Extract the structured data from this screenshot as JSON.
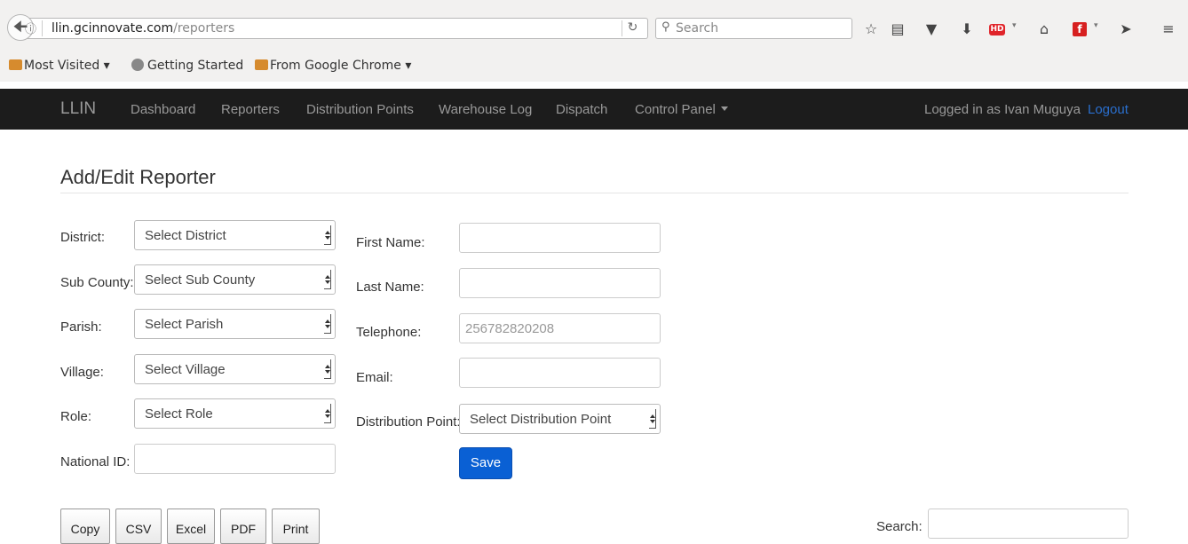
{
  "browser": {
    "url_host": "llin.gcinnovate.com",
    "url_path": "/reporters",
    "search_placeholder": "Search",
    "bookmarks": [
      "Most Visited ▾",
      "Getting Started",
      "From Google Chrome ▾"
    ]
  },
  "navbar": {
    "brand": "LLIN",
    "links": [
      "Dashboard",
      "Reporters",
      "Distribution Points",
      "Warehouse Log",
      "Dispatch",
      "Control Panel"
    ],
    "logged_in_text": "Logged in as Ivan Muguya",
    "logout": "Logout"
  },
  "page": {
    "title": "Add/Edit Reporter"
  },
  "form": {
    "district_label": "District:",
    "district_value": "Select District",
    "subcounty_label": "Sub County:",
    "subcounty_value": "Select Sub County",
    "parish_label": "Parish:",
    "parish_value": "Select Parish",
    "village_label": "Village:",
    "village_value": "Select Village",
    "role_label": "Role:",
    "role_value": "Select Role",
    "national_id_label": "National ID:",
    "national_id_value": "",
    "first_name_label": "First Name:",
    "first_name_value": "",
    "last_name_label": "Last Name:",
    "last_name_value": "",
    "telephone_label": "Telephone:",
    "telephone_placeholder": "256782820208",
    "email_label": "Email:",
    "email_value": "",
    "distribution_point_label": "Distribution Point:",
    "distribution_point_value": "Select Distribution Point",
    "save": "Save"
  },
  "table_tools": {
    "buttons": [
      "Copy",
      "CSV",
      "Excel",
      "PDF",
      "Print"
    ],
    "search_label": "Search:",
    "search_value": ""
  }
}
